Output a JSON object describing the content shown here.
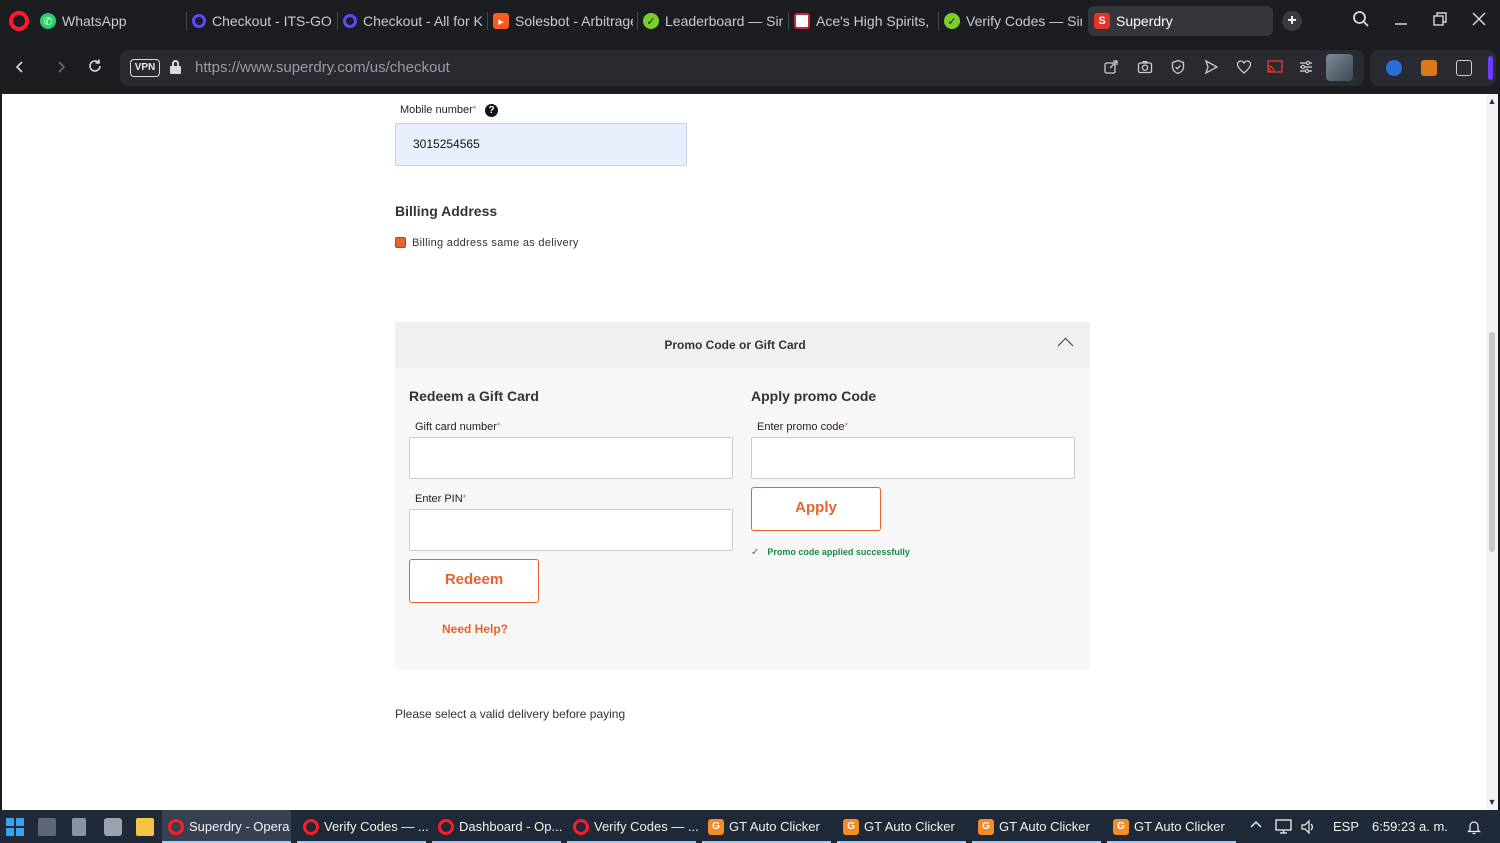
{
  "browser": {
    "tabs": [
      {
        "label": "WhatsApp",
        "icon": "whatsapp-icon",
        "color": "#25d366"
      },
      {
        "label": "Checkout - ITS-GOLF",
        "icon": "site-icon",
        "color": "#5b4bff"
      },
      {
        "label": "Checkout - All for Ke",
        "icon": "site-icon",
        "color": "#5b4bff"
      },
      {
        "label": "Solesbot - Arbitrage",
        "icon": "solesbot-icon",
        "color": "#ff5a1f"
      },
      {
        "label": "Leaderboard — Simp",
        "icon": "check-icon",
        "color": "#7ccf2b"
      },
      {
        "label": "Ace's High Spirits, D",
        "icon": "flag-icon",
        "color": "#c9263b"
      },
      {
        "label": "Verify Codes — Simp",
        "icon": "check-icon",
        "color": "#7ccf2b"
      },
      {
        "label": "Superdry",
        "icon": "superdry-icon",
        "color": "#e4322b"
      }
    ],
    "url_domain": "https://www.superdry.com",
    "url_path": "/us/checkout",
    "vpn_label": "VPN"
  },
  "form": {
    "mobile_label": "Mobile number",
    "mobile_value": "3015254565",
    "billing_title": "Billing Address",
    "billing_same_label": "Billing address same as delivery",
    "billing_same_checked": true
  },
  "promo": {
    "header_title": "Promo Code or Gift Card",
    "gift_title": "Redeem a Gift Card",
    "gift_number_label": "Gift card number",
    "pin_label": "Enter PIN",
    "redeem_button": "Redeem",
    "need_help": "Need Help?",
    "promo_title": "Apply promo Code",
    "promo_label": "Enter promo code",
    "apply_button": "Apply",
    "success_message": "Promo code applied successfully"
  },
  "delivery_note": "Please select a valid delivery before paying",
  "taskbar": {
    "items": [
      {
        "label": "Superdry - Opera",
        "type": "opera",
        "active": true
      },
      {
        "label": "Verify Codes — ...",
        "type": "opera",
        "active": false
      },
      {
        "label": "Dashboard - Op...",
        "type": "opera",
        "active": false
      },
      {
        "label": "Verify Codes — ...",
        "type": "opera",
        "active": false
      },
      {
        "label": "GT Auto Clicker",
        "type": "gt",
        "active": false
      },
      {
        "label": "GT Auto Clicker",
        "type": "gt",
        "active": false
      },
      {
        "label": "GT Auto Clicker",
        "type": "gt",
        "active": false
      },
      {
        "label": "GT Auto Clicker",
        "type": "gt",
        "active": false
      }
    ],
    "language": "ESP",
    "time": "6:59:23 a. m."
  },
  "colors": {
    "accent": "#e8622c",
    "success": "#1c8a4a",
    "autofill": "#e8f0fe"
  }
}
